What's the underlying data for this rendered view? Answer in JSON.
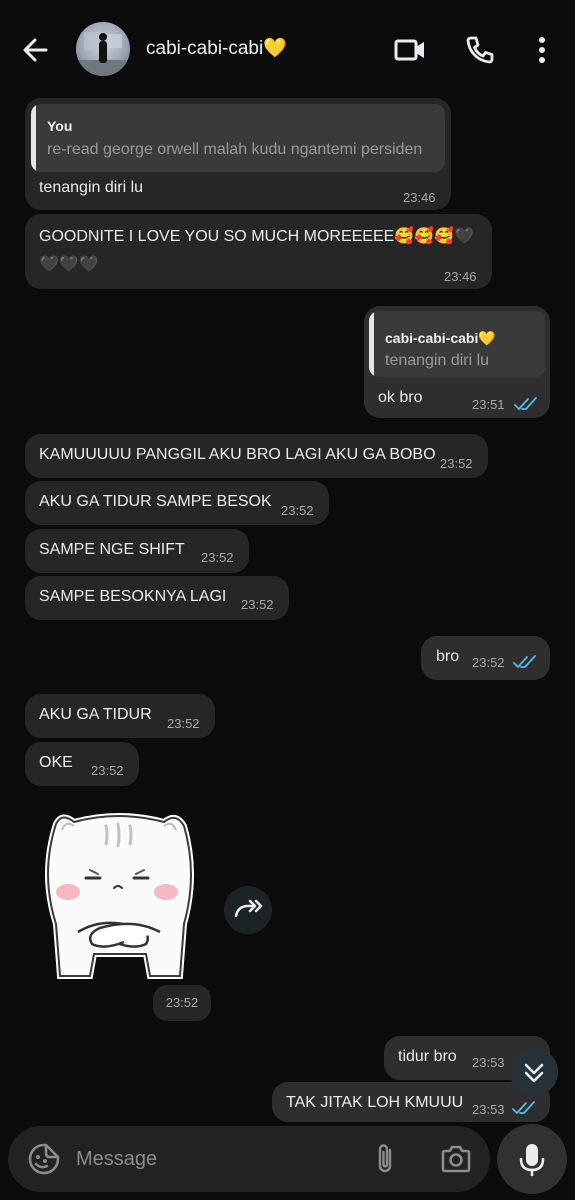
{
  "header": {
    "contact_name": "cabi-cabi-cabi💛"
  },
  "messages": [
    {
      "id": "m1",
      "direction": "in",
      "quote": {
        "author": "You",
        "text": "re-read george orwell malah kudu ngantemi persiden"
      },
      "text": "tenangin diri lu",
      "time": "23:46"
    },
    {
      "id": "m2",
      "direction": "in",
      "lines": [
        "GOODNITE I LOVE YOU SO MUCH MOREEEEE🥰🥰🥰🖤",
        "🖤🖤🖤"
      ],
      "time": "23:46"
    },
    {
      "id": "m3",
      "direction": "out",
      "quote": {
        "author": "cabi-cabi-cabi💛",
        "text": "tenangin diri lu"
      },
      "text": "ok bro",
      "time": "23:51",
      "status": "read"
    },
    {
      "id": "m4",
      "direction": "in",
      "text": "KAMUUUUU PANGGIL AKU BRO LAGI AKU GA BOBO",
      "time": "23:52"
    },
    {
      "id": "m5",
      "direction": "in",
      "text": "AKU GA TIDUR SAMPE BESOK",
      "time": "23:52"
    },
    {
      "id": "m6",
      "direction": "in",
      "text": "SAMPE NGE SHIFT",
      "time": "23:52"
    },
    {
      "id": "m7",
      "direction": "in",
      "text": "SAMPE BESOKNYA LAGI",
      "time": "23:52"
    },
    {
      "id": "m8",
      "direction": "out",
      "text": "bro",
      "time": "23:52",
      "status": "read"
    },
    {
      "id": "m9",
      "direction": "in",
      "text": "AKU GA TIDUR",
      "time": "23:52"
    },
    {
      "id": "m10",
      "direction": "in",
      "text": "OKE",
      "time": "23:52"
    },
    {
      "id": "m11",
      "direction": "in",
      "type": "sticker",
      "sticker": "sleepy-cat-arms-crossed",
      "time": "23:52"
    },
    {
      "id": "m12",
      "direction": "out",
      "text": "tidur bro",
      "time": "23:53",
      "status": "read"
    },
    {
      "id": "m13",
      "direction": "out",
      "text": "TAK JITAK LOH KMUUU",
      "time": "23:53",
      "status": "read"
    }
  ],
  "composer": {
    "placeholder": "Message"
  },
  "icons": {
    "back": "arrow-left-icon",
    "video": "video-call-icon",
    "call": "phone-icon",
    "menu": "more-vert-icon",
    "forward": "forward-icon",
    "scroll": "double-chevron-down-icon",
    "emoji": "sticker-icon",
    "attach": "paperclip-icon",
    "camera": "camera-icon",
    "mic": "mic-icon"
  },
  "colors": {
    "background": "#0b0b0b",
    "bubble_in": "#262626",
    "bubble_out": "#2e2e2e",
    "read_ticks": "#53bdeb"
  }
}
